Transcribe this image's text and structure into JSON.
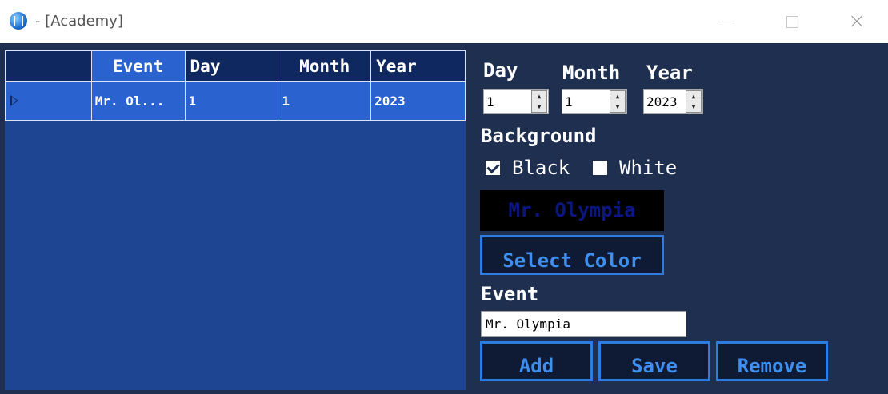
{
  "window": {
    "title": "- [Academy]"
  },
  "grid": {
    "columns": [
      "Event",
      "Day",
      "Month",
      "Year"
    ],
    "rows": [
      {
        "event": "Mr. Ol...",
        "day": "1",
        "month": "1",
        "year": "2023"
      }
    ]
  },
  "form": {
    "day_label": "Day",
    "month_label": "Month",
    "year_label": "Year",
    "day_value": "1",
    "month_value": "1",
    "year_value": "2023",
    "background_label": "Background",
    "black_label": "Black",
    "white_label": "White",
    "black_checked": true,
    "white_checked": false,
    "preview_text": "Mr. Olympia",
    "select_color_label": "Select Color",
    "event_label": "Event",
    "event_value": "Mr. Olympia",
    "add_label": "Add",
    "save_label": "Save",
    "remove_label": "Remove"
  },
  "colors": {
    "window_bg": "#1e2f4f",
    "grid_bg": "#1e4591",
    "grid_header": "#0f2860",
    "selected": "#2a62d0",
    "button_border": "#2d7de0",
    "preview_text": "#0b1680"
  },
  "icons": {
    "app": "app-logo-icon",
    "row_indicator": "row-pointer-icon",
    "minimize": "minimize-icon",
    "maximize": "maximize-icon",
    "close": "close-icon"
  }
}
